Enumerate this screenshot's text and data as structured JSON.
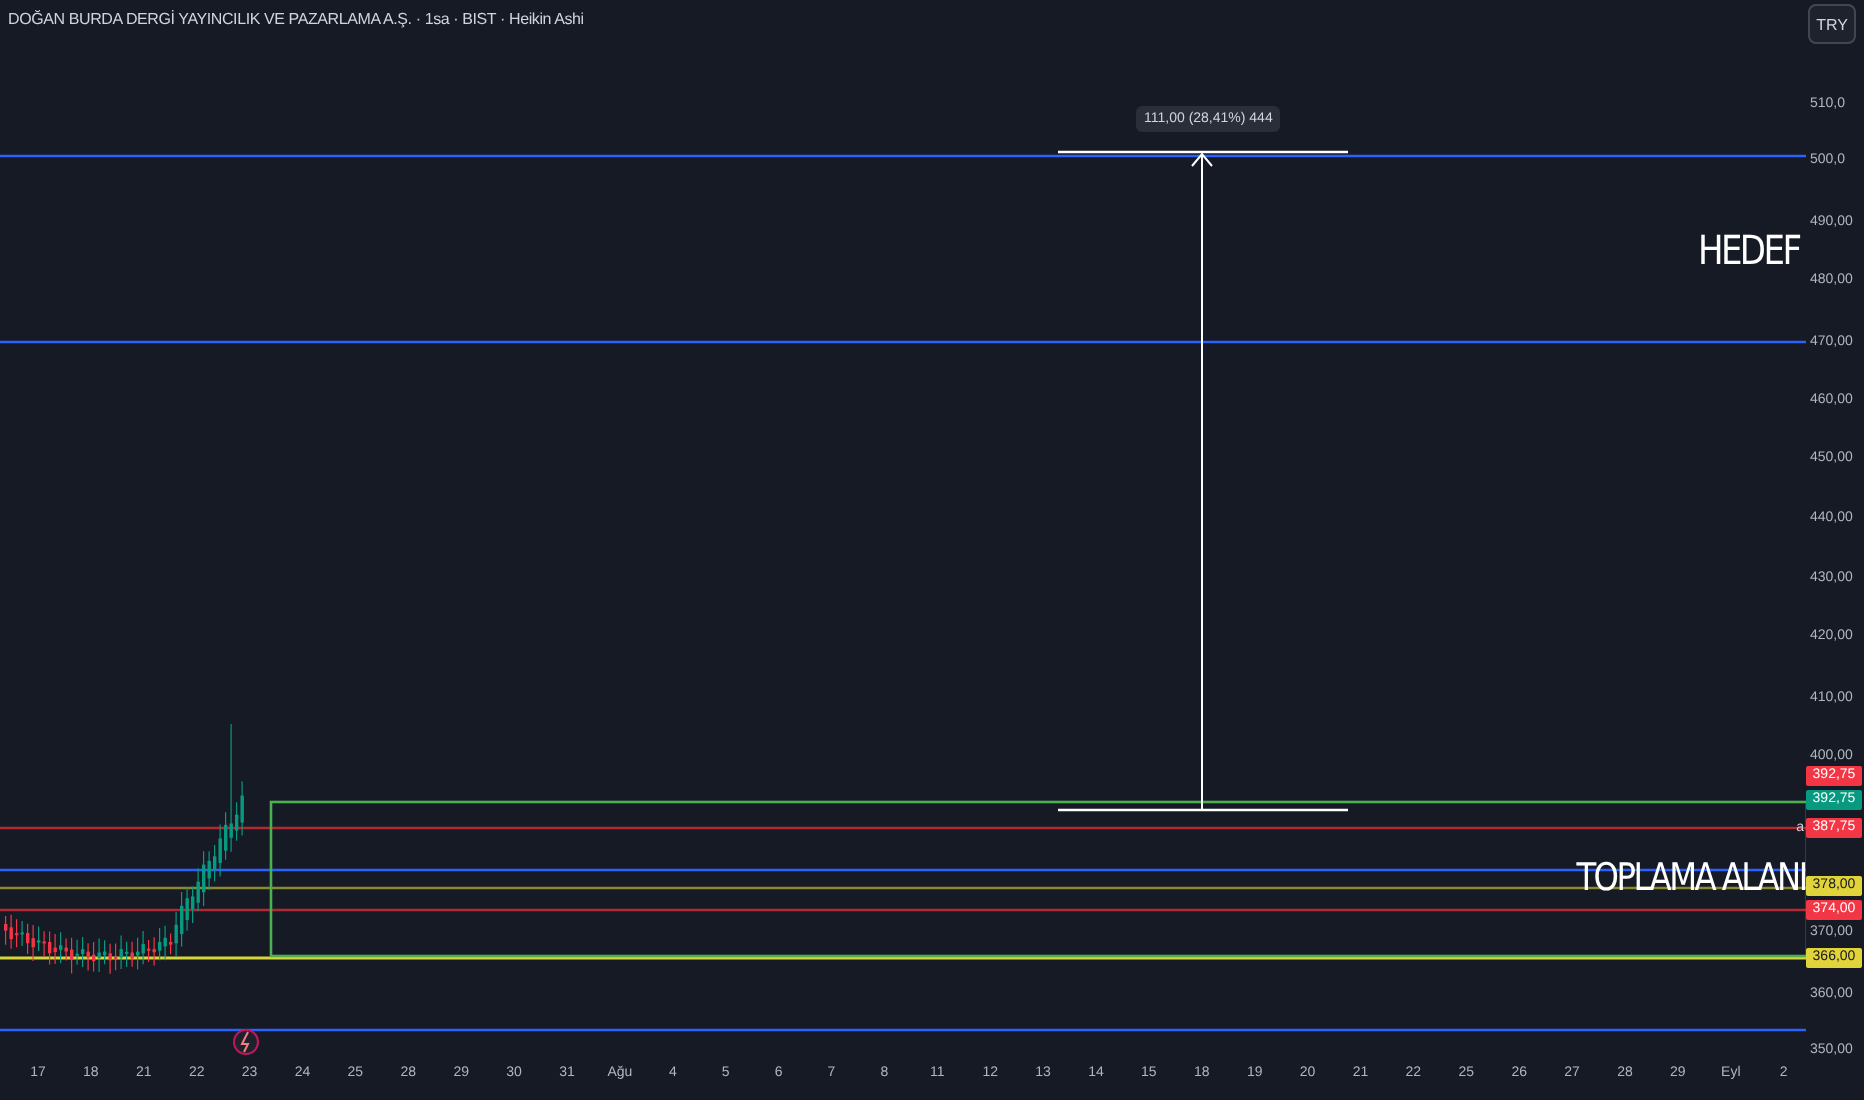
{
  "title": "DOĞAN BURDA DERGİ YAYINCILIK VE PAZARLAMA A.Ş. · 1sa · BIST · Heikin Ashi",
  "currency_button": "TRY",
  "measure_label": "111,00 (28,41%) 444",
  "annotations": [
    {
      "kind": "target",
      "text": "HEDEF"
    },
    {
      "kind": "zone",
      "text": "TOPLAMA ALANI"
    }
  ],
  "price_axis": [
    "510,0",
    "500,0",
    "490,00",
    "480,00",
    "470,00",
    "460,00",
    "450,00",
    "440,00",
    "430,00",
    "420,00",
    "410,00",
    "400,00",
    "370,00",
    "360,00",
    "350,00"
  ],
  "price_tags": [
    {
      "text": "392,75",
      "color": "#f23645"
    },
    {
      "text": "392,75",
      "color": "#089981"
    },
    {
      "text": "387,75",
      "color": "#f23645",
      "marker": "a"
    },
    {
      "text": "378,00",
      "color": "#e0d43a"
    },
    {
      "text": "374,00",
      "color": "#f23645"
    },
    {
      "text": "366,00",
      "color": "#e0d43a"
    }
  ],
  "time_axis": [
    "17",
    "18",
    "21",
    "22",
    "23",
    "24",
    "25",
    "28",
    "29",
    "30",
    "31",
    "Ağu",
    "4",
    "5",
    "6",
    "7",
    "8",
    "11",
    "12",
    "13",
    "14",
    "15",
    "18",
    "19",
    "20",
    "21",
    "22",
    "25",
    "26",
    "27",
    "28",
    "29",
    "Eyl",
    "2"
  ]
}
